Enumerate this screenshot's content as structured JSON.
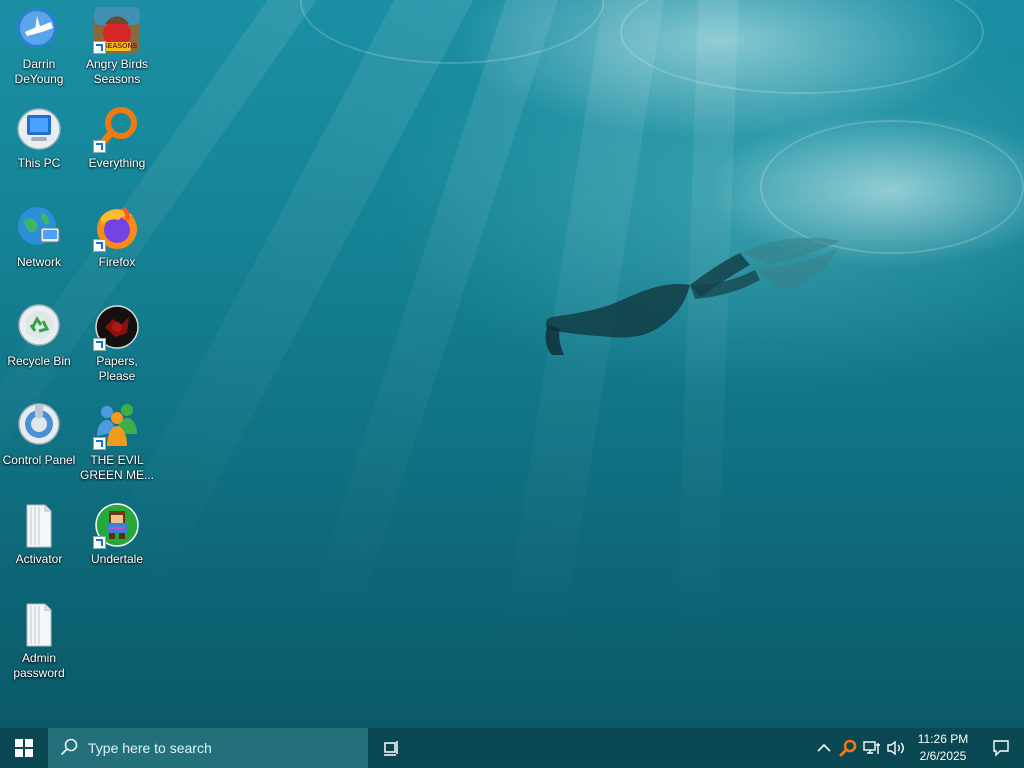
{
  "desktop": {
    "icons": [
      {
        "label": "Darrin DeYoung",
        "icon": "user-folder-icon"
      },
      {
        "label": "Angry Birds Seasons",
        "icon": "angry-birds-icon",
        "badge": "SEASONS"
      },
      {
        "label": "This PC",
        "icon": "computer-icon"
      },
      {
        "label": "Everything",
        "icon": "search-magnifier-icon"
      },
      {
        "label": "Network",
        "icon": "network-globe-icon"
      },
      {
        "label": "Firefox",
        "icon": "firefox-icon"
      },
      {
        "label": "Recycle Bin",
        "icon": "recycle-bin-icon"
      },
      {
        "label": "Papers, Please",
        "icon": "papers-please-icon"
      },
      {
        "label": "Control Panel",
        "icon": "control-panel-icon"
      },
      {
        "label": "THE EVIL GREEN ME...",
        "icon": "messenger-buddies-icon"
      },
      {
        "label": "Activator",
        "icon": "folder-icon"
      },
      {
        "label": "Undertale",
        "icon": "undertale-icon"
      },
      {
        "label": "Admin password",
        "icon": "folder-icon"
      }
    ]
  },
  "taskbar": {
    "search_placeholder": "Type here to search",
    "clock_time": "11:26 PM",
    "clock_date": "2/6/2025",
    "tray_icons": [
      "chevron-up-icon",
      "everything-search-icon",
      "network-icon",
      "volume-icon"
    ],
    "colors": {
      "taskbar_bg": "#0a4650",
      "search_bg": "#28787f"
    }
  }
}
